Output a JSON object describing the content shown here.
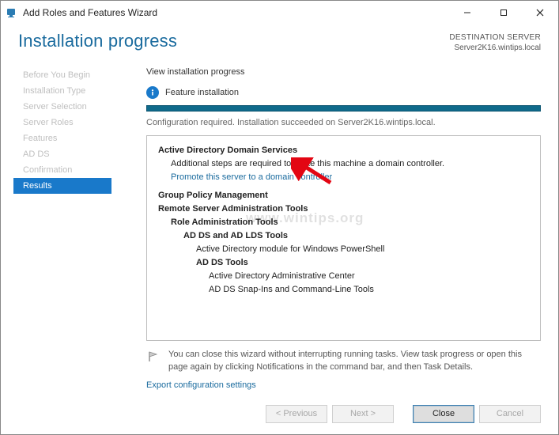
{
  "window": {
    "title": "Add Roles and Features Wizard"
  },
  "header": {
    "title": "Installation progress",
    "dest_label": "DESTINATION SERVER",
    "dest_value": "Server2K16.wintips.local"
  },
  "sidebar": {
    "steps": [
      "Before You Begin",
      "Installation Type",
      "Server Selection",
      "Server Roles",
      "Features",
      "AD DS",
      "Confirmation",
      "Results"
    ],
    "current_index": 7
  },
  "main": {
    "subheader": "View installation progress",
    "feature_status": "Feature installation",
    "config_msg": "Configuration required. Installation succeeded on Server2K16.wintips.local.",
    "results": {
      "adds_title": "Active Directory Domain Services",
      "adds_note": "Additional steps are required to make this machine a domain controller.",
      "promote_link": "Promote this server to a domain controller",
      "gpm": "Group Policy Management",
      "rsat": "Remote Server Administration Tools",
      "rat": "Role Administration Tools",
      "adlds": "AD DS and AD LDS Tools",
      "admodule": "Active Directory module for Windows PowerShell",
      "addstools": "AD DS Tools",
      "adac": "Active Directory Administrative Center",
      "snapins": "AD DS Snap-Ins and Command-Line Tools"
    },
    "flag_note": "You can close this wizard without interrupting running tasks. View task progress or open this page again by clicking Notifications in the command bar, and then Task Details.",
    "export_link": "Export configuration settings"
  },
  "footer": {
    "previous": "< Previous",
    "next": "Next >",
    "close": "Close",
    "cancel": "Cancel"
  },
  "watermark": "www.wintips.org"
}
